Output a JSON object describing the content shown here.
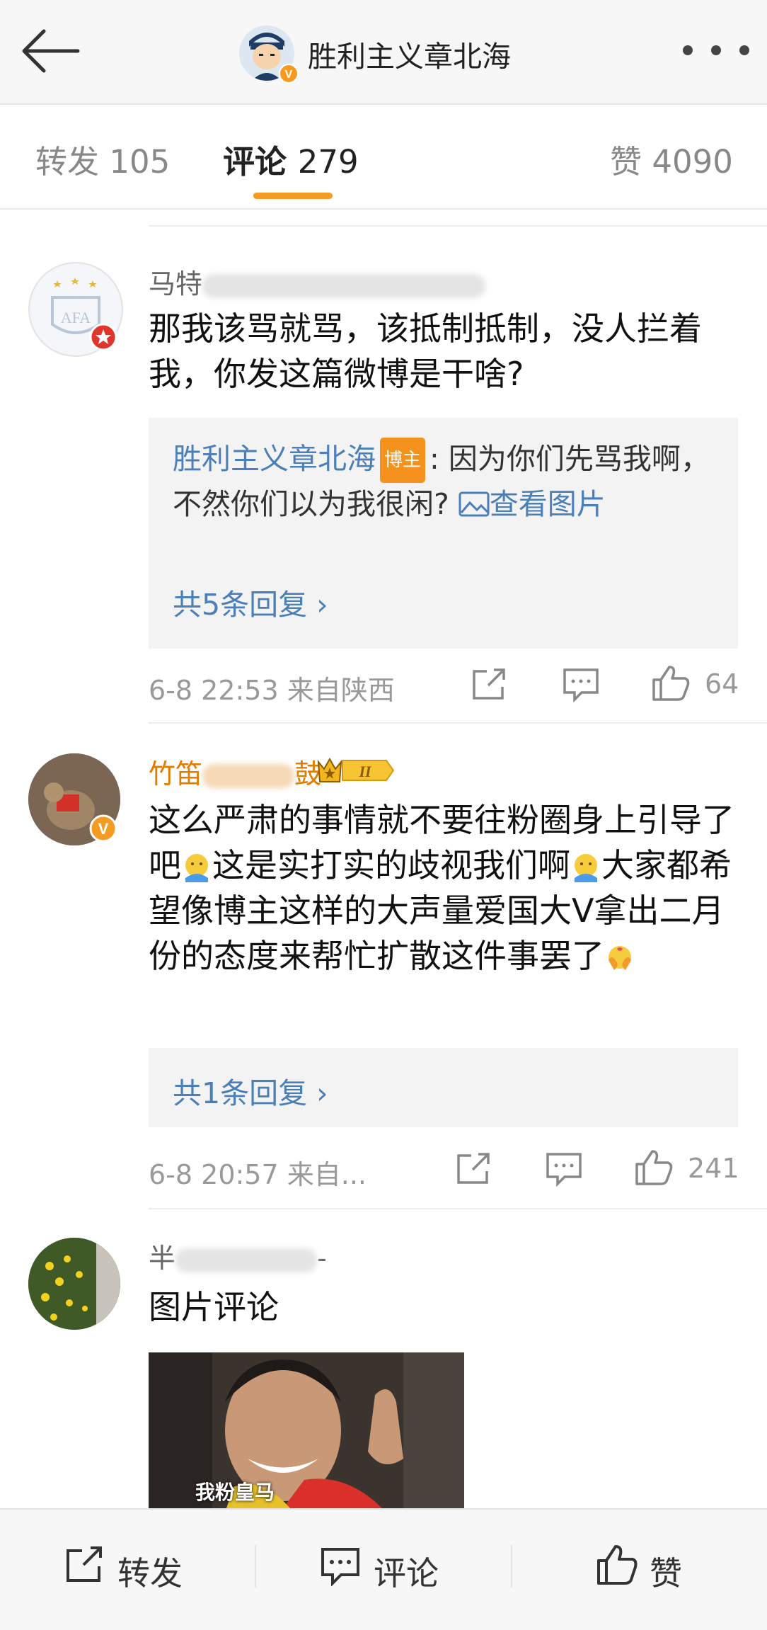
{
  "header": {
    "title": "胜利主义章北海",
    "avatar_badge": "V"
  },
  "tabs": [
    {
      "label": "转发",
      "count": "105"
    },
    {
      "label": "评论",
      "count": "279"
    },
    {
      "label": "赞",
      "count": "4090"
    }
  ],
  "comments": [
    {
      "user_prefix": "马特",
      "text": "那我该骂就骂，该抵制抵制，没人拦着我，你发这篇微博是干啥?",
      "reply": {
        "author": "胜利主义章北海",
        "author_badge": "博主",
        "text": ": 因为你们先骂我啊，不然你们以为我很闲? ",
        "view_image": "查看图片",
        "more": "共5条回复"
      },
      "time": "6-8 22:53",
      "location": "来自陕西",
      "likes": "64"
    },
    {
      "user_prefix": "竹笛",
      "user_suffix": "鼓",
      "level_badge": "II",
      "text_parts": [
        "这么严肃的事情就不要往粉圈身上引导了吧",
        "这是实打实的歧视我们啊",
        "大家都希望像博主这样的大声量爱国大V拿出二月份的态度来帮忙扩散这件事罢了"
      ],
      "reply_more": "共1条回复",
      "time": "6-8 20:57",
      "location": "来自...",
      "likes": "241"
    },
    {
      "user_prefix": "半",
      "text": "图片评论",
      "image_caption": "我粉皇马"
    }
  ],
  "bottom_bar": {
    "repost": "转发",
    "comment": "评论",
    "like": "赞"
  },
  "colors": {
    "accent": "#f59a23",
    "link": "#4a7fb8",
    "gold_name": "#e07c00"
  }
}
